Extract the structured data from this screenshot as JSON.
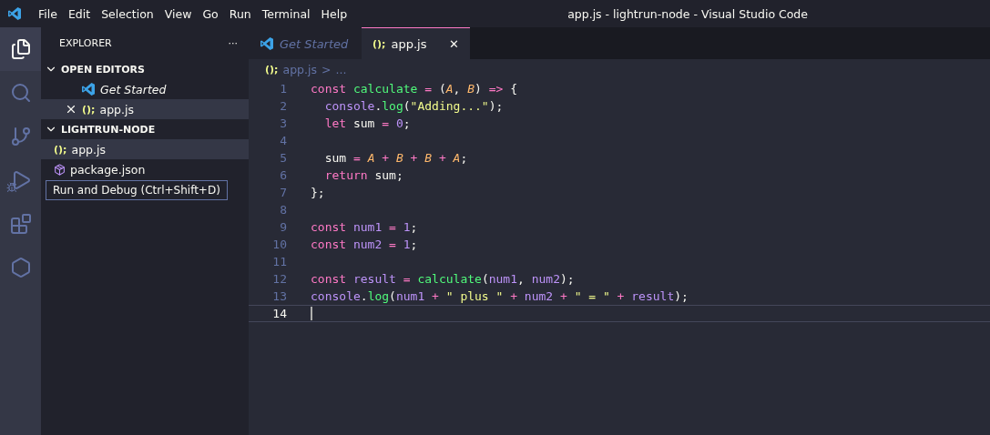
{
  "menu": [
    "File",
    "Edit",
    "Selection",
    "View",
    "Go",
    "Run",
    "Terminal",
    "Help"
  ],
  "window": {
    "title": "app.js - lightrun-node - Visual Studio Code"
  },
  "activity_bar": [
    {
      "kind": "files",
      "selected": true
    },
    {
      "kind": "search",
      "selected": false
    },
    {
      "kind": "source-control",
      "selected": false
    },
    {
      "kind": "run-debug",
      "selected": false
    },
    {
      "kind": "extensions",
      "selected": false
    },
    {
      "kind": "hexagon",
      "selected": false
    }
  ],
  "tooltip": "Run and Debug (Ctrl+Shift+D)",
  "sidebar": {
    "title": "EXPLORER",
    "more": "···",
    "sections": [
      {
        "title": "OPEN EDITORS",
        "expanded": true,
        "items": [
          {
            "kind": "welcome",
            "label": "Get Started",
            "selected": false,
            "close": false
          },
          {
            "kind": "js",
            "glyph": "();",
            "label": "app.js",
            "selected": true,
            "close": true
          }
        ]
      },
      {
        "title": "LIGHTRUN-NODE",
        "expanded": true,
        "items": [
          {
            "kind": "js",
            "glyph": "();",
            "label": "app.js",
            "selected": true,
            "close": false
          },
          {
            "kind": "json",
            "label": "package.json",
            "selected": false,
            "close": false
          }
        ]
      }
    ]
  },
  "tabs": [
    {
      "kind": "welcome",
      "label": "Get Started",
      "selected": false
    },
    {
      "kind": "js",
      "glyph": "();",
      "label": "app.js",
      "selected": true,
      "close": "✕"
    }
  ],
  "breadcrumb": {
    "glyph": "();",
    "file": "app.js",
    "separator": ">",
    "rest": "..."
  },
  "code": [
    {
      "number": "1",
      "current": false,
      "tokens": [
        {
          "text": "const ",
          "kind": "keyword"
        },
        {
          "text": "calculate",
          "kind": "function"
        },
        {
          "text": " = ",
          "kind": "operator"
        },
        {
          "text": "(",
          "kind": "plain"
        },
        {
          "text": "A",
          "kind": "param"
        },
        {
          "text": ", ",
          "kind": "plain"
        },
        {
          "text": "B",
          "kind": "param"
        },
        {
          "text": ") ",
          "kind": "plain"
        },
        {
          "text": "=>",
          "kind": "operator"
        },
        {
          "text": " {",
          "kind": "plain"
        }
      ]
    },
    {
      "number": "2",
      "current": false,
      "tokens": [
        {
          "text": "  console",
          "kind": "variable"
        },
        {
          "text": ".",
          "kind": "plain"
        },
        {
          "text": "log",
          "kind": "function"
        },
        {
          "text": "(",
          "kind": "plain"
        },
        {
          "text": "\"Adding...\"",
          "kind": "string"
        },
        {
          "text": ");",
          "kind": "plain"
        }
      ]
    },
    {
      "number": "3",
      "current": false,
      "tokens": [
        {
          "text": "  let",
          "kind": "keyword"
        },
        {
          "text": " sum ",
          "kind": "plain"
        },
        {
          "text": "= ",
          "kind": "operator"
        },
        {
          "text": "0",
          "kind": "number"
        },
        {
          "text": ";",
          "kind": "plain"
        }
      ]
    },
    {
      "number": "4",
      "current": false
    },
    {
      "number": "5",
      "current": false,
      "tokens": [
        {
          "text": "  sum ",
          "kind": "plain"
        },
        {
          "text": "= ",
          "kind": "operator"
        },
        {
          "text": "A",
          "kind": "param"
        },
        {
          "text": " + ",
          "kind": "operator"
        },
        {
          "text": "B",
          "kind": "param"
        },
        {
          "text": " + ",
          "kind": "operator"
        },
        {
          "text": "B",
          "kind": "param"
        },
        {
          "text": " + ",
          "kind": "operator"
        },
        {
          "text": "A",
          "kind": "param"
        },
        {
          "text": ";",
          "kind": "plain"
        }
      ]
    },
    {
      "number": "6",
      "current": false,
      "tokens": [
        {
          "text": "  return",
          "kind": "keyword"
        },
        {
          "text": " sum;",
          "kind": "plain"
        }
      ]
    },
    {
      "number": "7",
      "current": false,
      "tokens": [
        {
          "text": "};",
          "kind": "plain"
        }
      ]
    },
    {
      "number": "8",
      "current": false
    },
    {
      "number": "9",
      "current": false,
      "tokens": [
        {
          "text": "const ",
          "kind": "keyword"
        },
        {
          "text": "num1",
          "kind": "variable"
        },
        {
          "text": " = ",
          "kind": "operator"
        },
        {
          "text": "1",
          "kind": "number"
        },
        {
          "text": ";",
          "kind": "plain"
        }
      ]
    },
    {
      "number": "10",
      "current": false,
      "tokens": [
        {
          "text": "const ",
          "kind": "keyword"
        },
        {
          "text": "num2",
          "kind": "variable"
        },
        {
          "text": " = ",
          "kind": "operator"
        },
        {
          "text": "1",
          "kind": "number"
        },
        {
          "text": ";",
          "kind": "plain"
        }
      ]
    },
    {
      "number": "11",
      "current": false
    },
    {
      "number": "12",
      "current": false,
      "tokens": [
        {
          "text": "const ",
          "kind": "keyword"
        },
        {
          "text": "result",
          "kind": "variable"
        },
        {
          "text": " = ",
          "kind": "operator"
        },
        {
          "text": "calculate",
          "kind": "function"
        },
        {
          "text": "(",
          "kind": "plain"
        },
        {
          "text": "num1",
          "kind": "variable"
        },
        {
          "text": ", ",
          "kind": "plain"
        },
        {
          "text": "num2",
          "kind": "variable"
        },
        {
          "text": ");",
          "kind": "plain"
        }
      ]
    },
    {
      "number": "13",
      "current": false,
      "tokens": [
        {
          "text": "console",
          "kind": "variable"
        },
        {
          "text": ".",
          "kind": "plain"
        },
        {
          "text": "log",
          "kind": "function"
        },
        {
          "text": "(",
          "kind": "plain"
        },
        {
          "text": "num1",
          "kind": "variable"
        },
        {
          "text": " + ",
          "kind": "operator"
        },
        {
          "text": "\" plus \"",
          "kind": "string"
        },
        {
          "text": " + ",
          "kind": "operator"
        },
        {
          "text": "num2",
          "kind": "variable"
        },
        {
          "text": " + ",
          "kind": "operator"
        },
        {
          "text": "\" = \"",
          "kind": "string"
        },
        {
          "text": " + ",
          "kind": "operator"
        },
        {
          "text": "result",
          "kind": "variable"
        },
        {
          "text": ");",
          "kind": "plain"
        }
      ]
    },
    {
      "number": "14",
      "current": true
    }
  ]
}
